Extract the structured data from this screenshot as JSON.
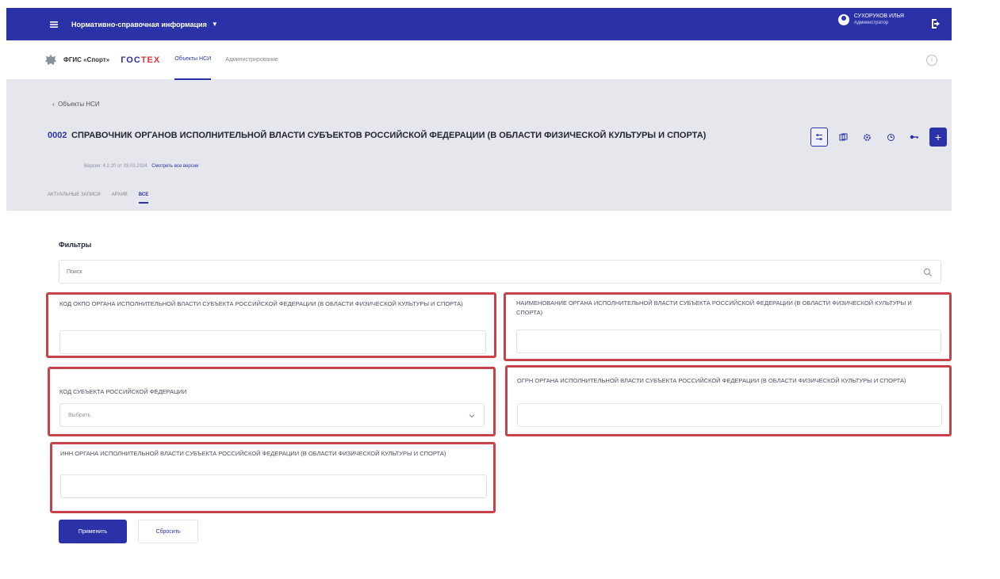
{
  "topbar": {
    "app_title": "Нормативно-справочная информация",
    "user_name": "СУХОРУКОВ ИЛЬЯ",
    "user_role": "Администратор"
  },
  "navbar": {
    "brand1": "ФГИС «Спорт»",
    "brand2_a": "ГОС",
    "brand2_b": "ТЕХ",
    "links": [
      "Объекты НСИ",
      "Администрирование"
    ]
  },
  "page": {
    "back": "Объекты НСИ",
    "code": "0002",
    "title": "СПРАВОЧНИК ОРГАНОВ ИСПОЛНИТЕЛЬНОЙ ВЛАСТИ СУБЪЕКТОВ РОССИЙСКОЙ ФЕДЕРАЦИИ (В ОБЛАСТИ ФИЗИЧЕСКОЙ КУЛЬТУРЫ И СПОРТА)",
    "version": "Версия: 4.2.20 от 03.03.2024",
    "version_link": "Смотреть все версии",
    "tabs": [
      "АКТУАЛЬНЫЕ ЗАПИСИ",
      "АРХИВ",
      "ВСЕ"
    ]
  },
  "filters": {
    "title": "Фильтры",
    "search_placeholder": "Поиск",
    "okpo_label": "КОД ОКПО ОРГАНА ИСПОЛНИТЕЛЬНОЙ ВЛАСТИ СУБЪЕКТА РОССИЙСКОЙ ФЕДЕРАЦИИ (В ОБЛАСТИ ФИЗИЧЕСКОЙ КУЛЬТУРЫ И СПОРТА)",
    "name_label": "НАИМЕНОВАНИЕ ОРГАНА ИСПОЛНИТЕЛЬНОЙ ВЛАСТИ СУБЪЕКТА РОССИЙСКОЙ ФЕДЕРАЦИИ (В ОБЛАСТИ ФИЗИЧЕСКОЙ КУЛЬТУРЫ И СПОРТА)",
    "subject_label": "КОД СУБЪЕКТА РОССИЙСКОЙ ФЕДЕРАЦИИ",
    "subject_placeholder": "Выбрать",
    "ogrn_label": "ОГРН ОРГАНА ИСПОЛНИТЕЛЬНОЙ ВЛАСТИ СУБЪЕКТА РОССИЙСКОЙ ФЕДЕРАЦИИ (В ОБЛАСТИ ФИЗИЧЕСКОЙ КУЛЬТУРЫ И СПОРТА)",
    "inn_label": "ИНН ОРГАНА ИСПОЛНИТЕЛЬНОЙ ВЛАСТИ СУБЪЕКТА РОССИЙСКОЙ ФЕДЕРАЦИИ (В ОБЛАСТИ ФИЗИЧЕСКОЙ КУЛЬТУРЫ И СПОРТА)",
    "apply": "Применить",
    "reset": "Сбросить"
  },
  "colors": {
    "primary": "#2b32a8",
    "highlight": "#c8424a",
    "header_bg": "#e6e7ec"
  }
}
